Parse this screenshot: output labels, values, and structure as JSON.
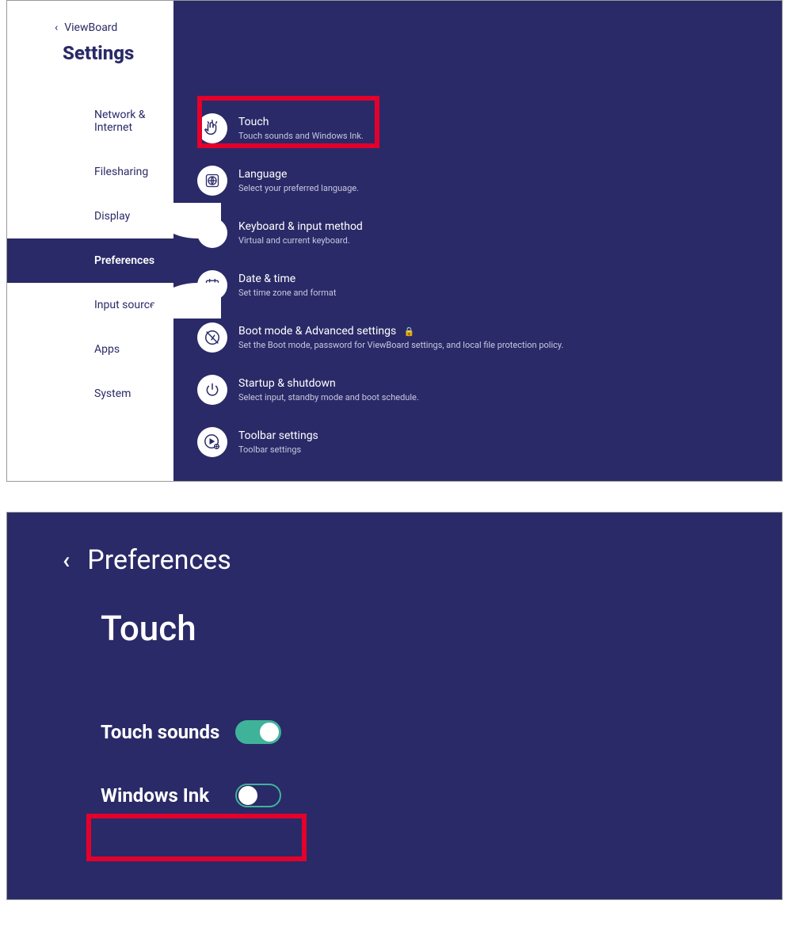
{
  "colors": {
    "bg": "#2a2a68",
    "accent": "#3fb39a",
    "highlight": "#e4002b"
  },
  "top": {
    "back_label": "ViewBoard",
    "title": "Settings",
    "nav": [
      {
        "label": "Network & Internet"
      },
      {
        "label": "Filesharing"
      },
      {
        "label": "Display"
      },
      {
        "label": "Preferences"
      },
      {
        "label": "Input source"
      },
      {
        "label": "Apps"
      },
      {
        "label": "System"
      }
    ],
    "active_index": 3,
    "items": [
      {
        "title": "Touch",
        "sub": "Touch sounds and Windows Ink.",
        "icon": "touch"
      },
      {
        "title": "Language",
        "sub": "Select your preferred language.",
        "icon": "globe"
      },
      {
        "title": "Keyboard & input method",
        "sub": "Virtual and current keyboard.",
        "icon": "keyboard"
      },
      {
        "title": "Date & time",
        "sub": "Set time zone and format",
        "icon": "calendar"
      },
      {
        "title": "Boot mode & Advanced settings",
        "sub": "Set the Boot mode, password for ViewBoard settings, and local file protection policy.",
        "icon": "boot",
        "locked": true
      },
      {
        "title": "Startup & shutdown",
        "sub": "Select input, standby mode and boot schedule.",
        "icon": "power"
      },
      {
        "title": "Toolbar settings",
        "sub": "Toolbar settings",
        "icon": "toolbar"
      }
    ]
  },
  "bottom": {
    "back_label": "Preferences",
    "title": "Touch",
    "options": [
      {
        "label": "Touch sounds",
        "state": "on"
      },
      {
        "label": "Windows Ink",
        "state": "off"
      }
    ]
  }
}
